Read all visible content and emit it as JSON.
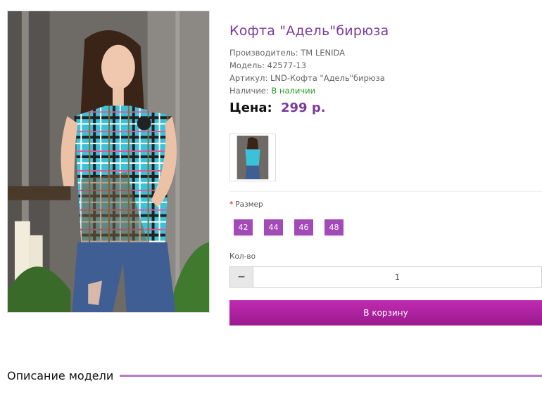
{
  "product": {
    "title": "Кофта \"Адель\"бирюза",
    "manufacturer_label": "Производитель:",
    "manufacturer": "TM LENIDA",
    "model_label": "Модель:",
    "model": "42577-13",
    "sku_label": "Артикул:",
    "sku": "LND-Кофта \"Адель\"бирюза",
    "availability_label": "Наличие:",
    "availability": "В наличии",
    "price_label": "Цена:",
    "price": "299 р."
  },
  "options": {
    "size_required_mark": "*",
    "size_label": "Размер",
    "sizes": [
      "42",
      "44",
      "46",
      "48"
    ]
  },
  "quantity": {
    "label": "Кол-во",
    "minus": "−",
    "value": "1"
  },
  "cart": {
    "button_label": "В корзину"
  },
  "description": {
    "heading": "Описание модели"
  },
  "colors": {
    "title": "#7b3aa0",
    "accent": "#a24bb6",
    "availability": "#2a9a2a",
    "cart_button": "#b025a4"
  }
}
